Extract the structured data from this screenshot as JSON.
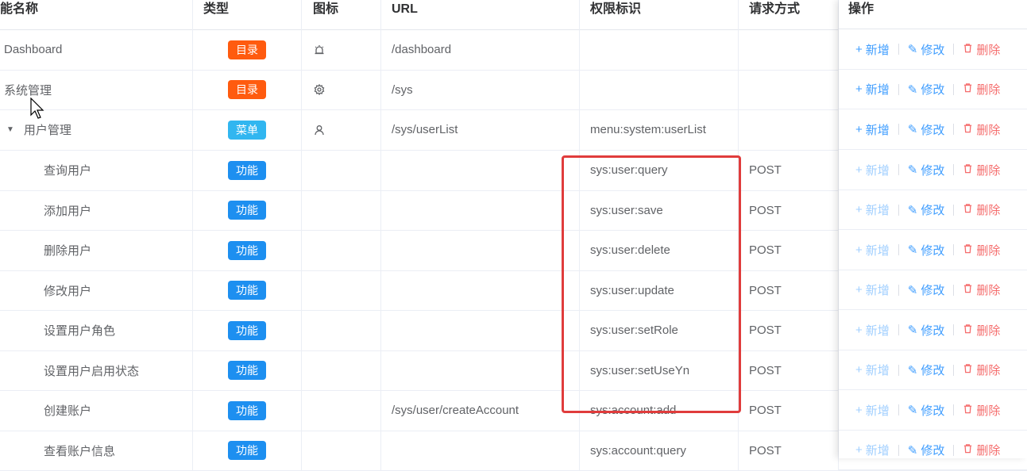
{
  "headers": {
    "name": "能名称",
    "type": "类型",
    "icon": "图标",
    "url": "URL",
    "perm": "权限标识",
    "method": "请求方式",
    "ops": "操作"
  },
  "ops_labels": {
    "add": "新增",
    "edit": "修改",
    "del": "删除"
  },
  "rows": [
    {
      "name": "Dashboard",
      "type": "目录",
      "icon": "alarm-icon",
      "url": "/dashboard",
      "perm": "",
      "method": ""
    },
    {
      "name": "系统管理",
      "type": "目录",
      "icon": "gear-icon",
      "url": "/sys",
      "perm": "",
      "method": ""
    },
    {
      "name": "用户管理",
      "type": "菜单",
      "icon": "user-icon",
      "url": "/sys/userList",
      "perm": "menu:system:userList",
      "method": ""
    },
    {
      "name": "查询用户",
      "type": "功能",
      "icon": "",
      "url": "",
      "perm": "sys:user:query",
      "method": "POST"
    },
    {
      "name": "添加用户",
      "type": "功能",
      "icon": "",
      "url": "",
      "perm": "sys:user:save",
      "method": "POST"
    },
    {
      "name": "删除用户",
      "type": "功能",
      "icon": "",
      "url": "",
      "perm": "sys:user:delete",
      "method": "POST"
    },
    {
      "name": "修改用户",
      "type": "功能",
      "icon": "",
      "url": "",
      "perm": "sys:user:update",
      "method": "POST"
    },
    {
      "name": "设置用户角色",
      "type": "功能",
      "icon": "",
      "url": "",
      "perm": "sys:user:setRole",
      "method": "POST"
    },
    {
      "name": "设置用户启用状态",
      "type": "功能",
      "icon": "",
      "url": "",
      "perm": "sys:user:setUseYn",
      "method": "POST"
    },
    {
      "name": "创建账户",
      "type": "功能",
      "icon": "",
      "url": "/sys/user/createAccount",
      "perm": "sys:account:add",
      "method": "POST"
    },
    {
      "name": "查看账户信息",
      "type": "功能",
      "icon": "",
      "url": "",
      "perm": "sys:account:query",
      "method": "POST"
    }
  ],
  "colors": {
    "dir": "#ff5b0f",
    "menu": "#31b6f0",
    "func": "#1d8ff0",
    "highlight": "#e03c3c"
  }
}
